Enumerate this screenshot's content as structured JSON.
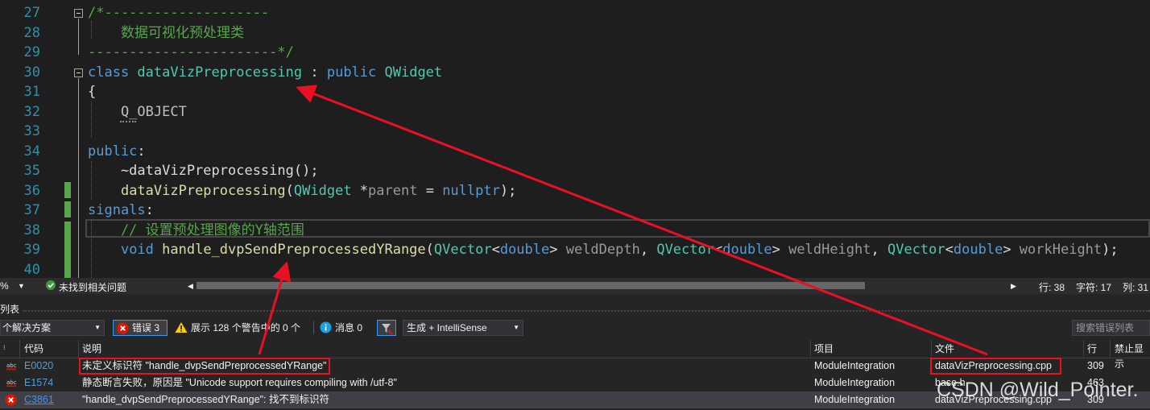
{
  "editor": {
    "line_numbers": [
      "27",
      "28",
      "29",
      "30",
      "31",
      "32",
      "33",
      "34",
      "35",
      "36",
      "37",
      "38",
      "39",
      "40"
    ],
    "lines": [
      [
        {
          "t": "/*--------------------",
          "c": "cmt"
        }
      ],
      [
        {
          "t": "    数据可视化预处理类",
          "c": "cmt"
        }
      ],
      [
        {
          "t": "-----------------------*/",
          "c": "cmt"
        }
      ],
      [
        {
          "t": "class ",
          "c": "kw"
        },
        {
          "t": "dataVizPreprocessing",
          "c": "cls"
        },
        {
          "t": " : ",
          "c": "pl"
        },
        {
          "t": "public ",
          "c": "kw"
        },
        {
          "t": "QWidget",
          "c": "cls"
        }
      ],
      [
        {
          "t": "{",
          "c": "pl"
        }
      ],
      [
        {
          "t": "    Q_OBJECT",
          "c": "mac"
        }
      ],
      [
        {
          "t": "",
          "c": "pl"
        }
      ],
      [
        {
          "t": "public",
          "c": "kw"
        },
        {
          "t": ":",
          "c": "pl"
        }
      ],
      [
        {
          "t": "    ~dataVizPreprocessing();",
          "c": "pl"
        }
      ],
      [
        {
          "t": "    ",
          "c": "pl"
        },
        {
          "t": "dataVizPreprocessing",
          "c": "fn"
        },
        {
          "t": "(",
          "c": "pl"
        },
        {
          "t": "QWidget",
          "c": "cls"
        },
        {
          "t": " *",
          "c": "pl"
        },
        {
          "t": "parent",
          "c": "prm"
        },
        {
          "t": " = ",
          "c": "pl"
        },
        {
          "t": "nullptr",
          "c": "kw"
        },
        {
          "t": ");",
          "c": "pl"
        }
      ],
      [
        {
          "t": "signals",
          "c": "kw"
        },
        {
          "t": ":",
          "c": "pl"
        }
      ],
      [
        {
          "t": "    // 设置预处理图像的Y轴范围",
          "c": "cmt"
        }
      ],
      [
        {
          "t": "    ",
          "c": "pl"
        },
        {
          "t": "void ",
          "c": "kw"
        },
        {
          "t": "handle_dvpSendPreprocessedYRange",
          "c": "fn"
        },
        {
          "t": "(",
          "c": "pl"
        },
        {
          "t": "QVector",
          "c": "cls"
        },
        {
          "t": "<",
          "c": "pl"
        },
        {
          "t": "double",
          "c": "kw"
        },
        {
          "t": "> ",
          "c": "pl"
        },
        {
          "t": "weldDepth",
          "c": "prm"
        },
        {
          "t": ", ",
          "c": "pl"
        },
        {
          "t": "QVector",
          "c": "cls"
        },
        {
          "t": "<",
          "c": "pl"
        },
        {
          "t": "double",
          "c": "kw"
        },
        {
          "t": "> ",
          "c": "pl"
        },
        {
          "t": "weldHeight",
          "c": "prm"
        },
        {
          "t": ", ",
          "c": "pl"
        },
        {
          "t": "QVector",
          "c": "cls"
        },
        {
          "t": "<",
          "c": "pl"
        },
        {
          "t": "double",
          "c": "kw"
        },
        {
          "t": "> ",
          "c": "pl"
        },
        {
          "t": "workHeight",
          "c": "prm"
        },
        {
          "t": ");",
          "c": "pl"
        }
      ],
      [
        {
          "t": "",
          "c": "pl"
        }
      ]
    ]
  },
  "status_strip": {
    "zoom": "%",
    "issues": "未找到相关问题",
    "line": "行: 38",
    "char": "字符: 17",
    "col": "列: 31"
  },
  "error_list": {
    "title": "列表",
    "scope": "个解决方案",
    "errors_btn": "错误 3",
    "warnings_btn": "展示 128 个警告中的 0 个",
    "messages_btn": "消息 0",
    "build_combo": "生成 + IntelliSense",
    "search_placeholder": "搜索错误列表",
    "columns": {
      "code": "代码",
      "desc": "说明",
      "project": "项目",
      "file": "文件",
      "line": "行",
      "suppress": "禁止显示"
    },
    "rows": [
      {
        "kind": "intellisense",
        "code": "E0020",
        "desc": "未定义标识符 \"handle_dvpSendPreprocessedYRange\"",
        "project": "ModuleIntegration",
        "file": "dataVizPreprocessing.cpp",
        "line": "309"
      },
      {
        "kind": "intellisense",
        "code": "E1574",
        "desc": "静态断言失败，原因是 \"Unicode support requires compiling with /utf-8\"",
        "project": "ModuleIntegration",
        "file": "base.h",
        "line": "463"
      },
      {
        "kind": "build",
        "code": "C3861",
        "desc": "\"handle_dvpSendPreprocessedYRange\": 找不到标识符",
        "project": "ModuleIntegration",
        "file": "dataVizPreprocessing.cpp",
        "line": "309"
      }
    ]
  },
  "watermark": "CSDN @Wild_Pointer.",
  "colors": {
    "highlight_box": "#e81123",
    "arrow": "#e81123",
    "error_icon": "#e51400",
    "warning_icon": "#ffcc00",
    "info_icon": "#1ba1e2"
  }
}
